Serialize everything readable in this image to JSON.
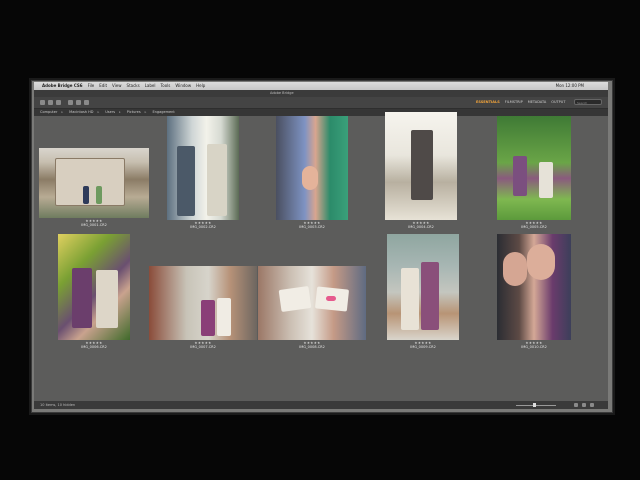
{
  "app": {
    "name": "Adobe Bridge CS6",
    "menu": [
      "File",
      "Edit",
      "View",
      "Stacks",
      "Label",
      "Tools",
      "Window",
      "Help"
    ],
    "clock": "Mon 12:00 PM",
    "window_title": "Adobe Bridge"
  },
  "toolbar": {
    "workspaces": [
      "ESSENTIALS",
      "FILMSTRIP",
      "METADATA",
      "OUTPUT"
    ],
    "active_workspace": "ESSENTIALS",
    "search_placeholder": "Search"
  },
  "path": {
    "crumbs": [
      "Computer",
      "Macintosh HD",
      "Users",
      "Pictures",
      "Engagement"
    ]
  },
  "thumbnails": [
    {
      "stars": "★★★★★",
      "name": "IMG_0001.CR2"
    },
    {
      "stars": "★★★★★",
      "name": "IMG_0002.CR2"
    },
    {
      "stars": "★★★★★",
      "name": "IMG_0003.CR2"
    },
    {
      "stars": "★★★★★",
      "name": "IMG_0004.CR2"
    },
    {
      "stars": "★★★★★",
      "name": "IMG_0005.CR2"
    },
    {
      "stars": "★★★★★",
      "name": "IMG_0006.CR2"
    },
    {
      "stars": "★★★★★",
      "name": "IMG_0007.CR2"
    },
    {
      "stars": "★★★★★",
      "name": "IMG_0008.CR2"
    },
    {
      "stars": "★★★★★",
      "name": "IMG_0009.CR2"
    },
    {
      "stars": "★★★★★",
      "name": "IMG_0010.CR2"
    }
  ],
  "status": {
    "text": "10 items, 10 hidden"
  },
  "colors": {
    "accent": "#f4a53a",
    "content_bg": "#5c5c5b"
  },
  "icons": [
    "home-icon",
    "back-icon",
    "forward-icon",
    "camera-icon",
    "rotate-icon",
    "trash-icon",
    "star-icon",
    "sort-icon"
  ]
}
